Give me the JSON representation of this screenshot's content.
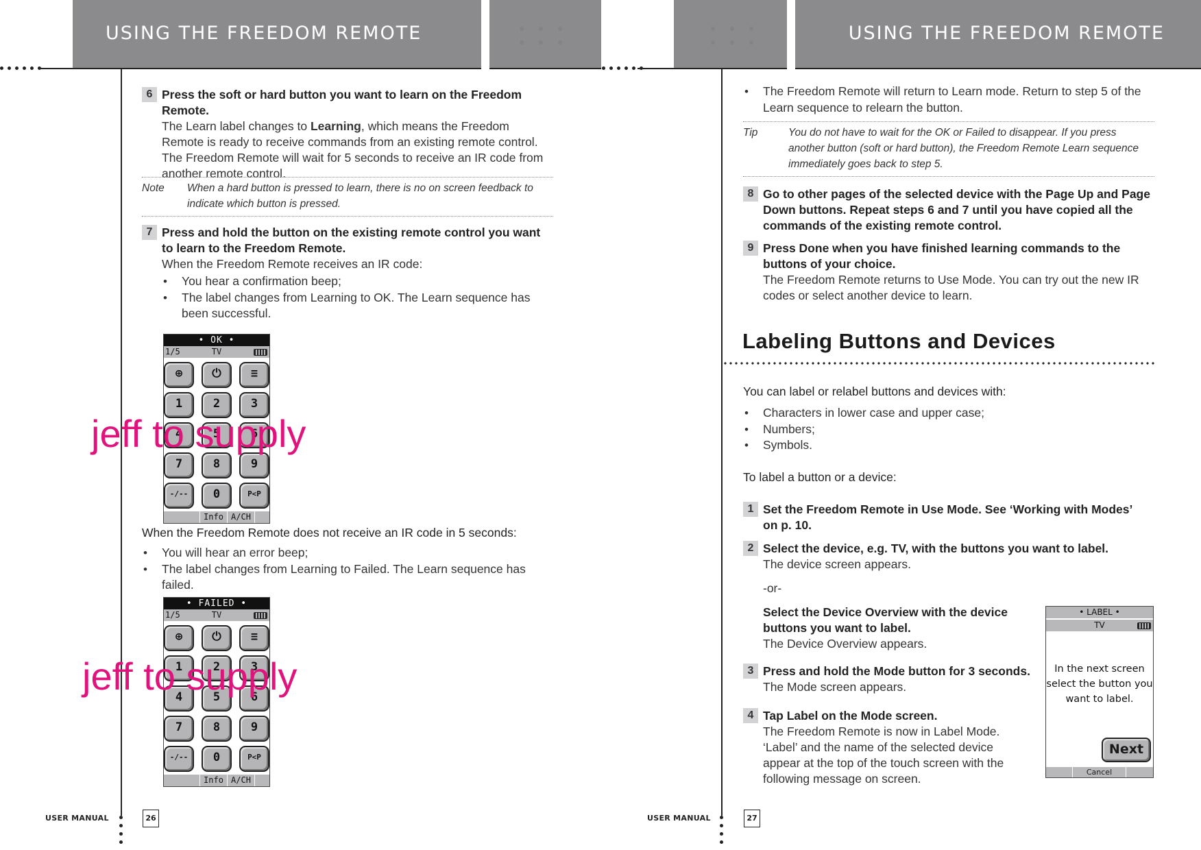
{
  "header": {
    "left_title": "USING THE FREEDOM REMOTE",
    "right_title": "USING THE FREEDOM REMOTE"
  },
  "left_page": {
    "step6": {
      "number": "6",
      "title": "Press the soft or hard button you want to learn on the Freedom Remote.",
      "desc_before": "The Learn label changes to ",
      "desc_bold": "Learning",
      "desc_after": ", which means the Freedom Remote is ready to receive commands from an existing remote control. The Freedom Remote will wait for 5 seconds to receive an IR code from another remote control."
    },
    "note": {
      "label": "Note",
      "text": "When a hard button is pressed to learn, there is no on screen feedback to indicate which button is pressed."
    },
    "step7": {
      "number": "7",
      "title": "Press and hold the button on the existing remote control you want to learn to the Freedom Remote.",
      "desc": "When the Freedom Remote receives an IR code:",
      "bullets": [
        "You hear a confirmation beep;",
        "The label changes from Learning to OK. The Learn sequence has been successful."
      ]
    },
    "screen_ok": {
      "banner": "• OK •",
      "page": "1/5",
      "device": "TV",
      "keys": [
        "⊕",
        "⏻",
        "≡",
        "1",
        "2",
        "3",
        "4",
        "5",
        "6",
        "7",
        "8",
        "9",
        "-/--",
        "0",
        "P<P"
      ],
      "soft_keys": [
        "",
        "Info",
        "A/CH",
        ""
      ]
    },
    "fail_intro": "When the Freedom Remote does not receive an IR code in 5 seconds:",
    "fail_bullets": [
      "You will hear an error beep;",
      "The label changes from Learning to Failed. The Learn sequence has failed."
    ],
    "screen_failed": {
      "banner": "• FAILED •",
      "page": "1/5",
      "device": "TV",
      "keys": [
        "⊕",
        "⏻",
        "≡",
        "1",
        "2",
        "3",
        "4",
        "5",
        "6",
        "7",
        "8",
        "9",
        "-/--",
        "0",
        "P<P"
      ],
      "soft_keys": [
        "",
        "Info",
        "A/CH",
        ""
      ]
    },
    "watermark": "jeff to supply",
    "footer_label": "USER MANUAL",
    "page_number": "26"
  },
  "right_page": {
    "top_bullet": "The Freedom Remote will return to Learn mode. Return to step 5 of the Learn sequence to relearn the button.",
    "tip": {
      "label": "Tip",
      "text": "You do not have to wait for the OK or Failed to disappear. If you press another button (soft or hard button), the Freedom Remote Learn sequence immediately goes back to step 5."
    },
    "step8": {
      "number": "8",
      "title": "Go to other pages of the selected device with the Page Up and Page Down buttons. Repeat steps 6 and 7 until you have copied all the commands of the existing remote control."
    },
    "step9": {
      "number": "9",
      "title_before": "Press ",
      "title_bold": "Done",
      "title_after": " when you have finished learning commands to the buttons of your choice.",
      "desc": "The Freedom Remote returns to Use Mode. You can try out the new IR codes or select another device to learn."
    },
    "section_heading": "Labeling Buttons and Devices",
    "intro": "You can label or relabel buttons and devices with:",
    "intro_bullets": [
      "Characters in lower case and upper case;",
      "Numbers;",
      "Symbols."
    ],
    "to_label": "To label a button or a device:",
    "lstep1": {
      "number": "1",
      "title": "Set the Freedom Remote in Use Mode. See ‘Working with Modes’ on p. 10."
    },
    "lstep2": {
      "number": "2",
      "title": "Select the device, e.g. TV, with the buttons you want to label.",
      "desc": "The device screen appears.",
      "or": "-or-",
      "alt_title": "Select the Device Overview with the device buttons you want to label.",
      "alt_desc": "The Device Overview appears."
    },
    "lstep3": {
      "number": "3",
      "title_before": "Press and hold the ",
      "title_bold": "Mode",
      "title_after": " button for 3 seconds.",
      "desc": "The Mode screen appears."
    },
    "lstep4": {
      "number": "4",
      "title_before": "Tap ",
      "title_bold": "Label",
      "title_after": " on the Mode screen.",
      "desc": "The Freedom Remote is now in Label Mode. ‘Label’ and the name of the selected device appear at the top of the touch screen with the following message on screen."
    },
    "label_screen": {
      "banner": "• LABEL •",
      "device": "TV",
      "message": "In the next screen select the button you want to label.",
      "next_button": "Next",
      "cancel": "Cancel"
    },
    "footer_label": "USER MANUAL",
    "page_number": "27"
  }
}
